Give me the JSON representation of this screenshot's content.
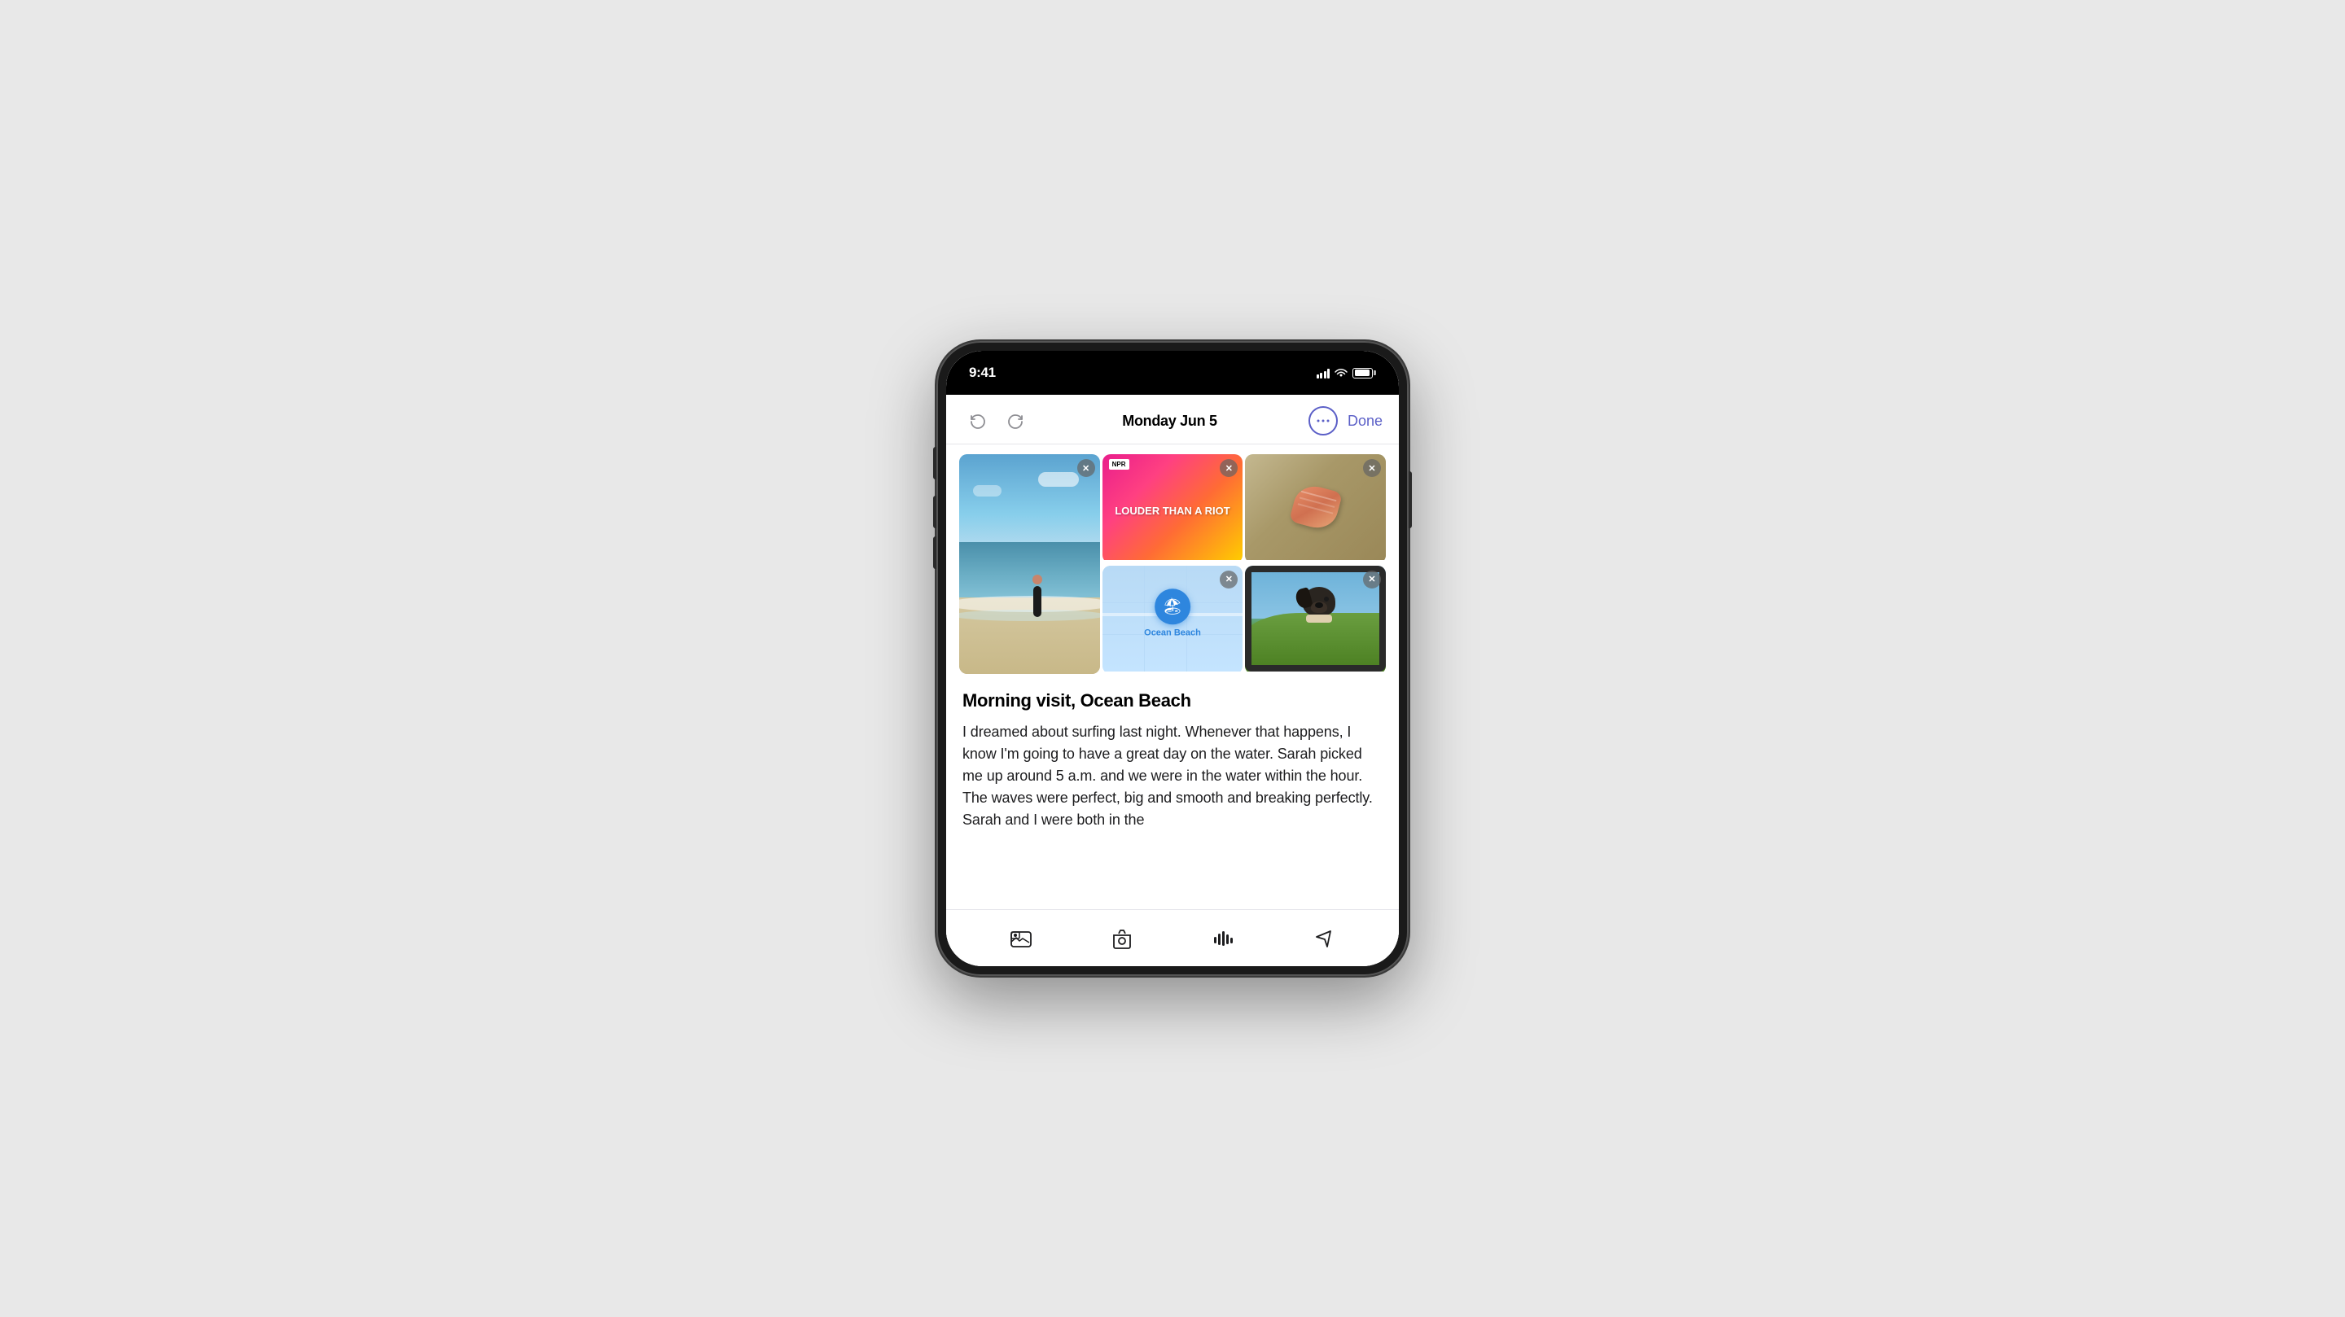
{
  "phone": {
    "status_bar": {
      "time": "9:41"
    }
  },
  "nav": {
    "title": "Monday Jun 5",
    "done_label": "Done",
    "more_label": "•••"
  },
  "attachments": [
    {
      "id": "beach-photo",
      "type": "photo",
      "alt": "Person standing in ocean waves"
    },
    {
      "id": "podcast",
      "type": "podcast",
      "network": "NPR",
      "title": "LOUDER THAN A RIOT"
    },
    {
      "id": "shell",
      "type": "photo",
      "alt": "Seashell on sand"
    },
    {
      "id": "map",
      "type": "map",
      "location": "Ocean Beach"
    },
    {
      "id": "dog",
      "type": "photo",
      "alt": "Dog hanging out of car window"
    }
  ],
  "entry": {
    "title": "Morning visit, Ocean Beach",
    "body": "I dreamed about surfing last night. Whenever that happens, I know I'm going to have a great day on the water. Sarah picked me up around 5 a.m. and we were in the water within the hour. The waves were perfect, big and smooth and breaking perfectly. Sarah and I were both in the"
  },
  "toolbar": {
    "photo_library_label": "Photo Library",
    "camera_label": "Camera",
    "audio_label": "Audio",
    "location_label": "Location"
  }
}
